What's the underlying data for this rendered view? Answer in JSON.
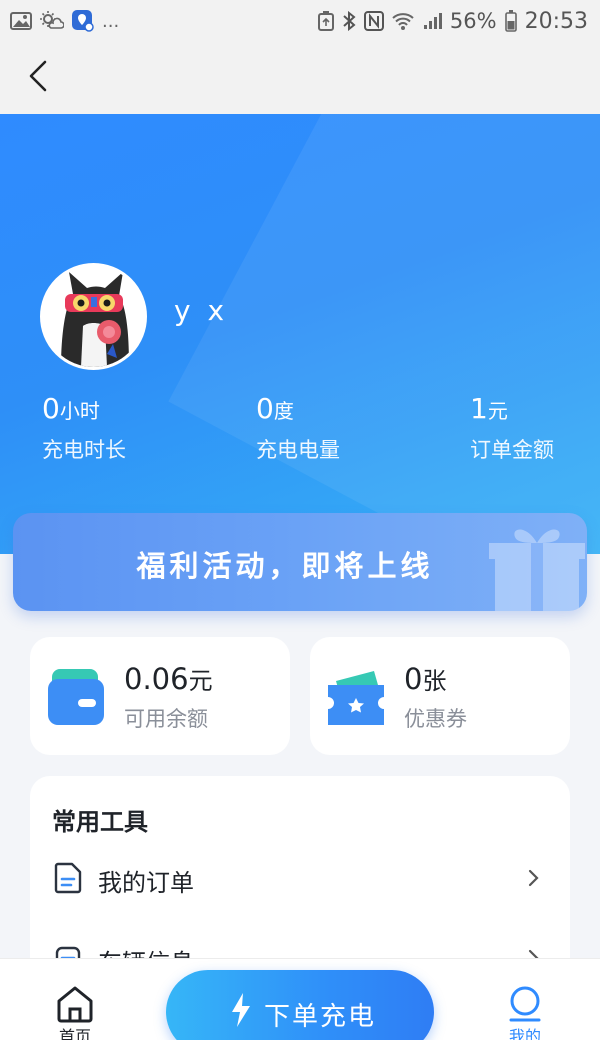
{
  "status_bar": {
    "icons_left": [
      "image-icon",
      "weather-icon",
      "location-badge-icon",
      "more-dots"
    ],
    "more_label": "...",
    "icons_right": [
      "storage-icon",
      "bluetooth-icon",
      "nfc-icon",
      "wifi-icon",
      "signal-icon"
    ],
    "battery": "56%",
    "time": "20:53"
  },
  "nav": {
    "back_icon": "chevron-left-icon"
  },
  "profile": {
    "username": "y x",
    "avatar": "avatar-cat"
  },
  "stats": [
    {
      "value": "0",
      "unit": "小时",
      "label": "充电时长"
    },
    {
      "value": "0",
      "unit": "度",
      "label": "充电电量"
    },
    {
      "value": "1",
      "unit": "元",
      "label": "订单金额"
    }
  ],
  "promo": {
    "text": "福利活动，即将上线",
    "icon": "gift-icon"
  },
  "wallet": {
    "balance_value": "0.06",
    "balance_unit": "元",
    "balance_label": "可用余额",
    "coupon_value": "0",
    "coupon_unit": "张",
    "coupon_label": "优惠券"
  },
  "tools": {
    "title": "常用工具",
    "items": [
      {
        "label": "我的订单",
        "icon": "document-icon"
      },
      {
        "label": "车辆信息",
        "icon": "car-icon"
      }
    ]
  },
  "tab_bar": {
    "home_label": "首页",
    "charge_label": "下单充电",
    "mine_label": "我的"
  },
  "colors": {
    "primary": "#2f8bff",
    "hero_end": "#37b2f6",
    "promo": "#6aa2f6",
    "text": "#1f2329",
    "muted": "#8a8f99"
  }
}
